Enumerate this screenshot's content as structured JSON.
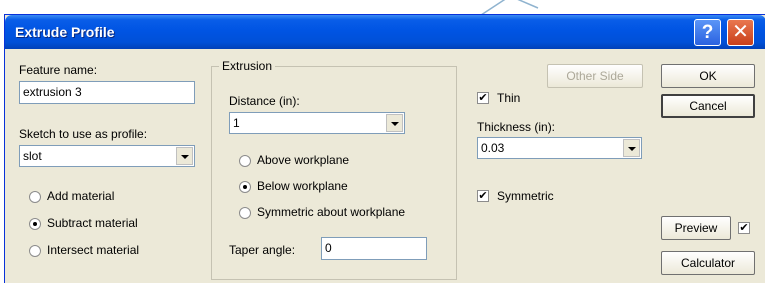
{
  "window": {
    "title": "Extrude Profile"
  },
  "title_buttons": {
    "help": "?",
    "close": "✕"
  },
  "left": {
    "feature_name_label": "Feature name:",
    "feature_name_value": "extrusion 3",
    "sketch_label": "Sketch to use as profile:",
    "sketch_value": "slot",
    "options": [
      {
        "label": "Add material",
        "selected": false
      },
      {
        "label": "Subtract material",
        "selected": true
      },
      {
        "label": "Intersect material",
        "selected": false
      }
    ]
  },
  "extrusion": {
    "group_label": "Extrusion",
    "distance_label": "Distance (in):",
    "distance_value": "1",
    "directions": [
      {
        "label": "Above workplane",
        "selected": false
      },
      {
        "label": "Below workplane",
        "selected": true
      },
      {
        "label": "Symmetric about workplane",
        "selected": false
      }
    ],
    "taper_label": "Taper angle:",
    "taper_value": "0"
  },
  "right": {
    "other_side_label": "Other Side",
    "thin_label": "Thin",
    "thin_checked": true,
    "thickness_label": "Thickness (in):",
    "thickness_value": "0.03",
    "symmetric_label": "Symmetric",
    "symmetric_checked": true
  },
  "buttons": {
    "ok": "OK",
    "cancel": "Cancel",
    "preview": "Preview",
    "preview_checked": true,
    "calculator": "Calculator"
  },
  "check_mark": "✔"
}
